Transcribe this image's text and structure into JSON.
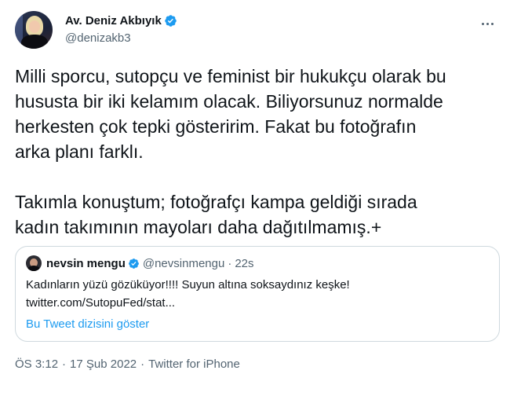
{
  "author": {
    "display_name": "Av. Deniz Akbıyık",
    "handle": "@denizakb3",
    "verified": true
  },
  "tweet": {
    "paragraph1": [
      "Milli sporcu, sutopçu ve feminist bir hukukçu olarak bu",
      "hususta bir iki kelamım olacak. Biliyorsunuz normalde",
      "herkesten çok tepki gösteririm. Fakat bu fotoğrafın",
      "arka planı farklı."
    ],
    "paragraph2": [
      "Takımla konuştum; fotoğrafçı kampa geldiği sırada",
      "kadın takımının mayoları daha dağıtılmamış.+"
    ]
  },
  "quote": {
    "display_name": "nevsin mengu",
    "handle": "@nevsinmengu",
    "separator": "·",
    "time": "22s",
    "line1": "Kadınların yüzü gözüküyor!!!! Suyun altına soksaydınız keşke!",
    "line2": "twitter.com/SutopuFed/stat...",
    "show_thread": "Bu Tweet dizisini göster"
  },
  "meta": {
    "time": "ÖS 3:12",
    "date": "17 Şub 2022",
    "source": "Twitter for iPhone",
    "separator": "·"
  },
  "colors": {
    "verified_blue": "#1d9bf0",
    "link_blue": "#1d9bf0",
    "secondary_text": "#536471",
    "border": "#cfd9de"
  },
  "icons": {
    "verified": "verified-badge-icon",
    "more": "more-options-icon"
  }
}
